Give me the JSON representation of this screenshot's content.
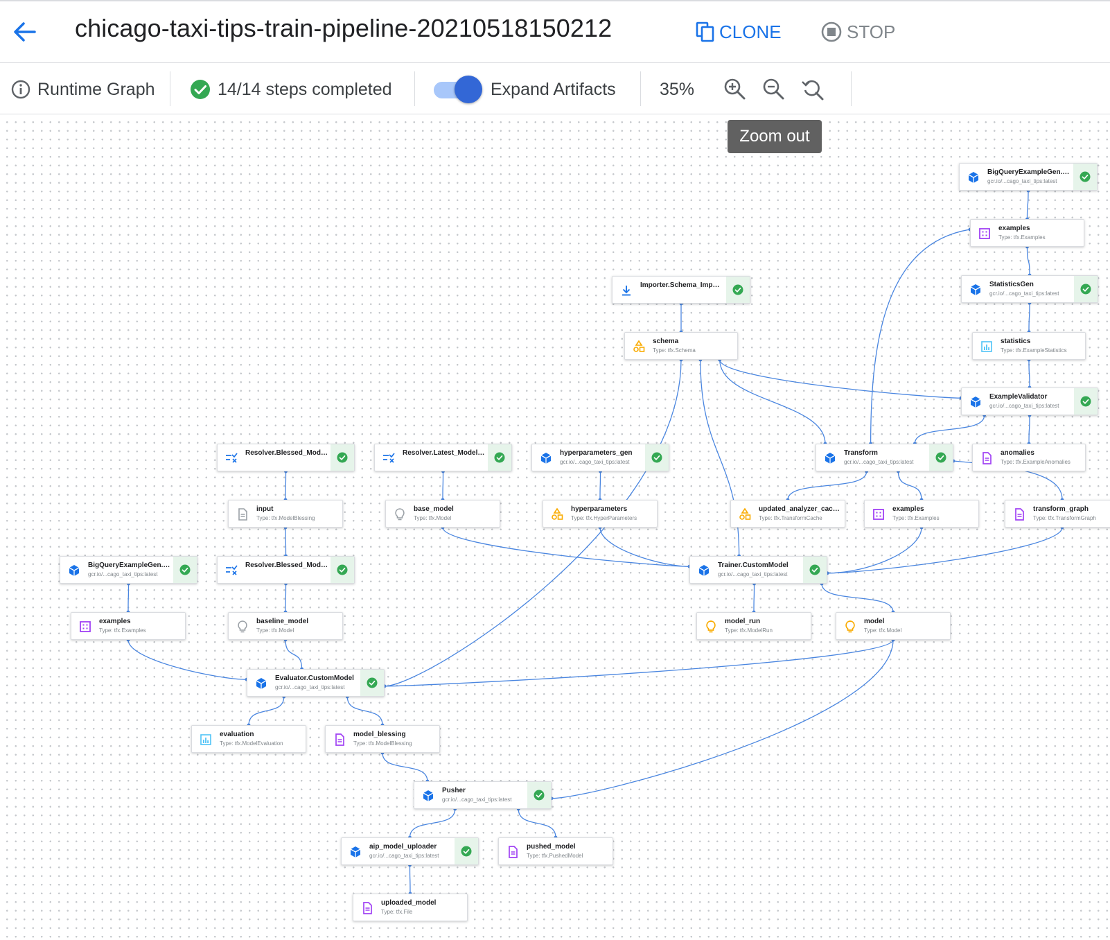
{
  "header": {
    "title": "chicago-taxi-tips-train-pipeline-20210518150212",
    "clone_label": "CLONE",
    "stop_label": "STOP"
  },
  "toolbar": {
    "runtime_graph_label": "Runtime Graph",
    "steps_completed": "14/14 steps completed",
    "expand_artifacts_label": "Expand Artifacts",
    "expand_artifacts_on": true,
    "zoom_level": "35%",
    "tooltip": "Zoom out"
  },
  "colors": {
    "accent": "#1a73e8",
    "edge": "#4a86e0",
    "success": "#34a853",
    "success_bg": "#e6f4ea",
    "artifact_examples": "#a142f4",
    "artifact_schema": "#f9ab00"
  },
  "graph": {
    "nodes": [
      {
        "id": "bq_train",
        "kind": "execution",
        "icon": "cube-icon",
        "name": "BigQueryExampleGen.Tr...",
        "sub": "gcr.io/...cago_taxi_tips:latest",
        "status": "success"
      },
      {
        "id": "examples_train",
        "kind": "artifact",
        "icon": "examples-icon",
        "name": "examples",
        "sub": "Type: tfx.Examples"
      },
      {
        "id": "statsgen",
        "kind": "execution",
        "icon": "cube-icon",
        "name": "StatisticsGen",
        "sub": "gcr.io/...cago_taxi_tips:latest",
        "status": "success"
      },
      {
        "id": "statistics",
        "kind": "artifact",
        "icon": "statistics-icon",
        "name": "statistics",
        "sub": "Type: tfx.ExampleStatistics"
      },
      {
        "id": "importer",
        "kind": "execution",
        "icon": "download-icon",
        "name": "Importer.Schema_Import...",
        "sub": "",
        "status": "success"
      },
      {
        "id": "schema",
        "kind": "artifact",
        "icon": "schema-icon",
        "name": "schema",
        "sub": "Type: tfx.Schema"
      },
      {
        "id": "examplevalidator",
        "kind": "execution",
        "icon": "cube-icon",
        "name": "ExampleValidator",
        "sub": "gcr.io/...cago_taxi_tips:latest",
        "status": "success"
      },
      {
        "id": "anomalies",
        "kind": "artifact",
        "icon": "document-icon",
        "name": "anomalies",
        "sub": "Type: tfx.ExampleAnomalies"
      },
      {
        "id": "transform",
        "kind": "execution",
        "icon": "cube-icon",
        "name": "Transform",
        "sub": "gcr.io/...cago_taxi_tips:latest",
        "status": "success"
      },
      {
        "id": "resolver_blessed1",
        "kind": "execution",
        "icon": "resolver-icon",
        "name": "Resolver.Blessed_Model...",
        "sub": "",
        "status": "success"
      },
      {
        "id": "resolver_latest",
        "kind": "execution",
        "icon": "resolver-icon",
        "name": "Resolver.Latest_Model_R...",
        "sub": "",
        "status": "success"
      },
      {
        "id": "hparams_gen",
        "kind": "execution",
        "icon": "cube-icon",
        "name": "hyperparameters_gen",
        "sub": "gcr.io/...cago_taxi_tips:latest",
        "status": "success"
      },
      {
        "id": "input",
        "kind": "artifact",
        "icon": "document-gray-icon",
        "name": "input",
        "sub": "Type: tfx.ModelBlessing"
      },
      {
        "id": "base_model",
        "kind": "artifact",
        "icon": "bulb-gray-icon",
        "name": "base_model",
        "sub": "Type: tfx.Model"
      },
      {
        "id": "hyperparameters",
        "kind": "artifact",
        "icon": "schema-icon",
        "name": "hyperparameters",
        "sub": "Type: tfx.HyperParameters"
      },
      {
        "id": "analyzer_cache",
        "kind": "artifact",
        "icon": "schema-icon",
        "name": "updated_analyzer_cache",
        "sub": "Type: tfx.TransformCache"
      },
      {
        "id": "examples_transformed",
        "kind": "artifact",
        "icon": "examples-icon",
        "name": "examples",
        "sub": "Type: tfx.Examples"
      },
      {
        "id": "transform_graph",
        "kind": "artifact",
        "icon": "document-icon",
        "name": "transform_graph",
        "sub": "Type: tfx.TransformGraph"
      },
      {
        "id": "bq_test",
        "kind": "execution",
        "icon": "cube-icon",
        "name": "BigQueryExampleGen.Te...",
        "sub": "gcr.io/...cago_taxi_tips:latest",
        "status": "success"
      },
      {
        "id": "resolver_blessed2",
        "kind": "execution",
        "icon": "resolver-icon",
        "name": "Resolver.Blessed_Model...",
        "sub": "",
        "status": "success"
      },
      {
        "id": "trainer",
        "kind": "execution",
        "icon": "cube-icon",
        "name": "Trainer.CustomModel",
        "sub": "gcr.io/...cago_taxi_tips:latest",
        "status": "success"
      },
      {
        "id": "examples_test",
        "kind": "artifact",
        "icon": "examples-icon",
        "name": "examples",
        "sub": "Type: tfx.Examples"
      },
      {
        "id": "baseline_model",
        "kind": "artifact",
        "icon": "bulb-gray-icon",
        "name": "baseline_model",
        "sub": "Type: tfx.Model"
      },
      {
        "id": "model_run",
        "kind": "artifact",
        "icon": "bulb-icon",
        "name": "model_run",
        "sub": "Type: tfx.ModelRun"
      },
      {
        "id": "model",
        "kind": "artifact",
        "icon": "bulb-icon",
        "name": "model",
        "sub": "Type: tfx.Model"
      },
      {
        "id": "evaluator",
        "kind": "execution",
        "icon": "cube-icon",
        "name": "Evaluator.CustomModel",
        "sub": "gcr.io/...cago_taxi_tips:latest",
        "status": "success"
      },
      {
        "id": "evaluation",
        "kind": "artifact",
        "icon": "statistics-icon",
        "name": "evaluation",
        "sub": "Type: tfx.ModelEvaluation"
      },
      {
        "id": "model_blessing",
        "kind": "artifact",
        "icon": "document-icon",
        "name": "model_blessing",
        "sub": "Type: tfx.ModelBlessing"
      },
      {
        "id": "pusher",
        "kind": "execution",
        "icon": "cube-icon",
        "name": "Pusher",
        "sub": "gcr.io/...cago_taxi_tips:latest",
        "status": "success"
      },
      {
        "id": "aip_uploader",
        "kind": "execution",
        "icon": "cube-icon",
        "name": "aip_model_uploader",
        "sub": "gcr.io/...cago_taxi_tips:latest",
        "status": "success"
      },
      {
        "id": "pushed_model",
        "kind": "artifact",
        "icon": "document-icon",
        "name": "pushed_model",
        "sub": "Type: tfx.PushedModel"
      },
      {
        "id": "uploaded_model",
        "kind": "artifact",
        "icon": "document-icon",
        "name": "uploaded_model",
        "sub": "Type: tfx.File"
      }
    ],
    "edges": [
      [
        "bq_train",
        "examples_train"
      ],
      [
        "examples_train",
        "statsgen"
      ],
      [
        "examples_train",
        "transform"
      ],
      [
        "statsgen",
        "statistics"
      ],
      [
        "statistics",
        "examplevalidator"
      ],
      [
        "examplevalidator",
        "anomalies"
      ],
      [
        "examplevalidator",
        "transform"
      ],
      [
        "importer",
        "schema"
      ],
      [
        "schema",
        "examplevalidator"
      ],
      [
        "schema",
        "transform"
      ],
      [
        "schema",
        "trainer"
      ],
      [
        "schema",
        "evaluator"
      ],
      [
        "resolver_blessed1",
        "input"
      ],
      [
        "input",
        "resolver_blessed2"
      ],
      [
        "resolver_latest",
        "base_model"
      ],
      [
        "hparams_gen",
        "hyperparameters"
      ],
      [
        "transform",
        "analyzer_cache"
      ],
      [
        "transform",
        "examples_transformed"
      ],
      [
        "transform",
        "transform_graph"
      ],
      [
        "base_model",
        "trainer"
      ],
      [
        "hyperparameters",
        "trainer"
      ],
      [
        "examples_transformed",
        "trainer"
      ],
      [
        "transform_graph",
        "trainer"
      ],
      [
        "bq_test",
        "examples_test"
      ],
      [
        "resolver_blessed2",
        "baseline_model"
      ],
      [
        "trainer",
        "model_run"
      ],
      [
        "trainer",
        "model"
      ],
      [
        "examples_test",
        "evaluator"
      ],
      [
        "baseline_model",
        "evaluator"
      ],
      [
        "model",
        "evaluator"
      ],
      [
        "model",
        "pusher"
      ],
      [
        "evaluator",
        "evaluation"
      ],
      [
        "evaluator",
        "model_blessing"
      ],
      [
        "model_blessing",
        "pusher"
      ],
      [
        "pusher",
        "aip_uploader"
      ],
      [
        "pusher",
        "pushed_model"
      ],
      [
        "aip_uploader",
        "uploaded_model"
      ]
    ]
  }
}
